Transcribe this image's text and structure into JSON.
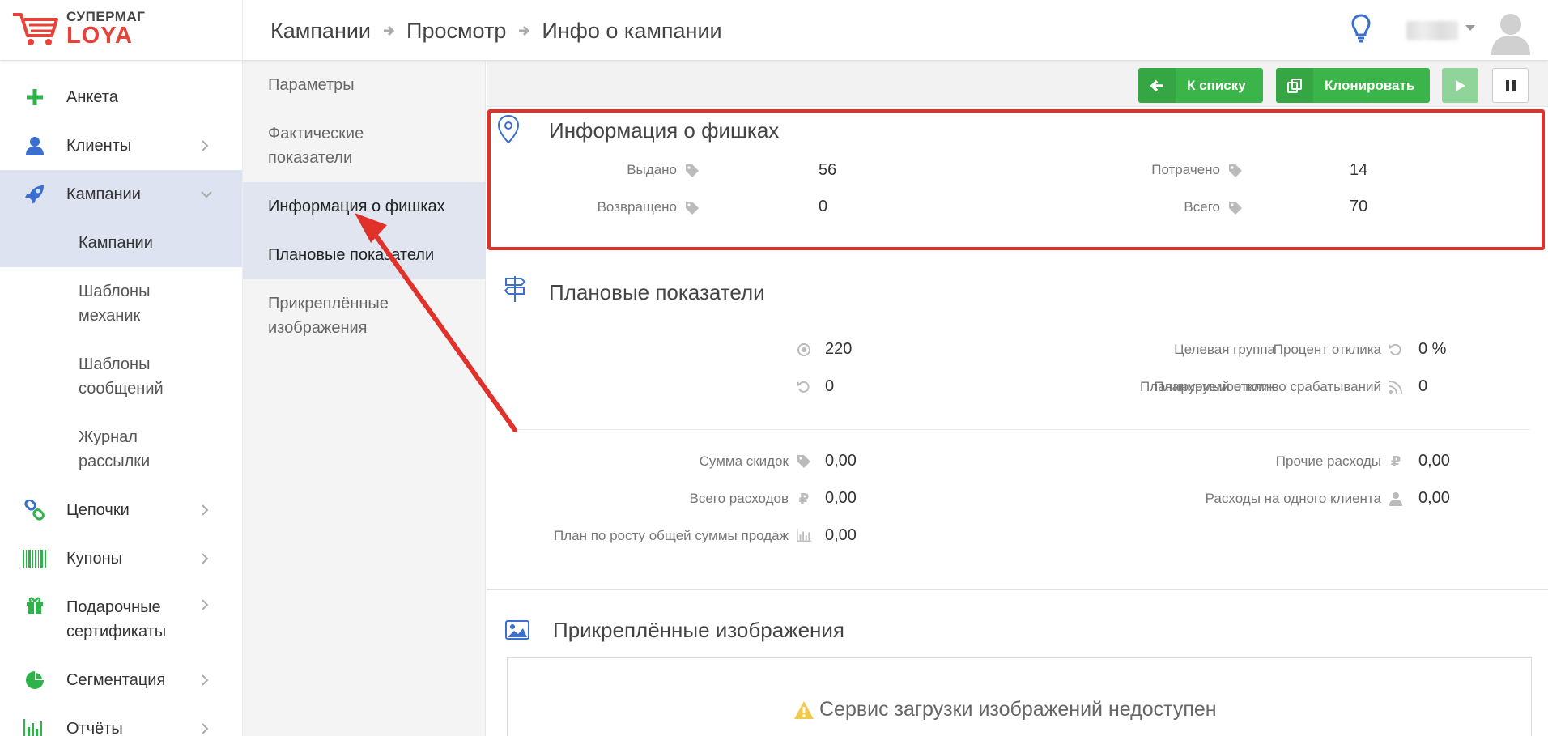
{
  "brand": {
    "line1": "СУПЕРМАГ",
    "line2": "LOYA",
    "accent": "#e8433a"
  },
  "breadcrumb": [
    "Кампании",
    "Просмотр",
    "Инфо о кампании"
  ],
  "sidebar": {
    "items": [
      {
        "label": "Анкета",
        "icon": "plus-icon"
      },
      {
        "label": "Клиенты",
        "icon": "user-icon"
      },
      {
        "label": "Кампании",
        "icon": "rocket-icon"
      },
      {
        "label": "Цепочки",
        "icon": "chain-icon"
      },
      {
        "label": "Купоны",
        "icon": "barcode-icon"
      },
      {
        "label": "Подарочные сертификаты",
        "icon": "gift-icon"
      },
      {
        "label": "Сегментация",
        "icon": "pie-chart-icon"
      },
      {
        "label": "Отчёты",
        "icon": "bar-chart-icon"
      }
    ],
    "subitems": [
      "Кампании",
      "Шаблоны механик",
      "Шаблоны сообщений",
      "Журнал рассылки"
    ]
  },
  "subnav": [
    "Параметры",
    "Фактические показатели",
    "Информация о фишках",
    "Плановые показатели",
    "Прикреплённые изображения"
  ],
  "toolbar": {
    "to_list": "К списку",
    "clone": "Клонировать"
  },
  "chips": {
    "title": "Информация о фишках",
    "issued_label": "Выдано",
    "issued": "56",
    "returned_label": "Возвращено",
    "returned": "0",
    "spent_label": "Потрачено",
    "spent": "14",
    "total_label": "Всего",
    "total": "70"
  },
  "plan": {
    "title": "Плановые показатели",
    "target_group_label": "Целевая группа",
    "target_group": "220",
    "planned_response_label": "Планируемый отклик",
    "planned_response": "0",
    "response_pct_label": "Процент отклика",
    "response_pct": "0 %",
    "planned_triggers_label": "Планируемое кол-во срабатываний",
    "planned_triggers": "0",
    "discount_sum_label": "Сумма скидок",
    "discount_sum": "0,00",
    "total_costs_label": "Всего расходов",
    "total_costs": "0,00",
    "sales_growth_label": "План по росту общей суммы продаж",
    "sales_growth": "0,00",
    "other_costs_label": "Прочие расходы",
    "other_costs": "0,00",
    "cost_per_client_label": "Расходы на одного клиента",
    "cost_per_client": "0,00"
  },
  "images": {
    "title": "Прикреплённые изображения",
    "warning": "Сервис загрузки изображений недоступен"
  },
  "colors": {
    "green": "#3bb54a",
    "highlight": "#e0312b",
    "icon_blue": "#3a6fd0"
  }
}
